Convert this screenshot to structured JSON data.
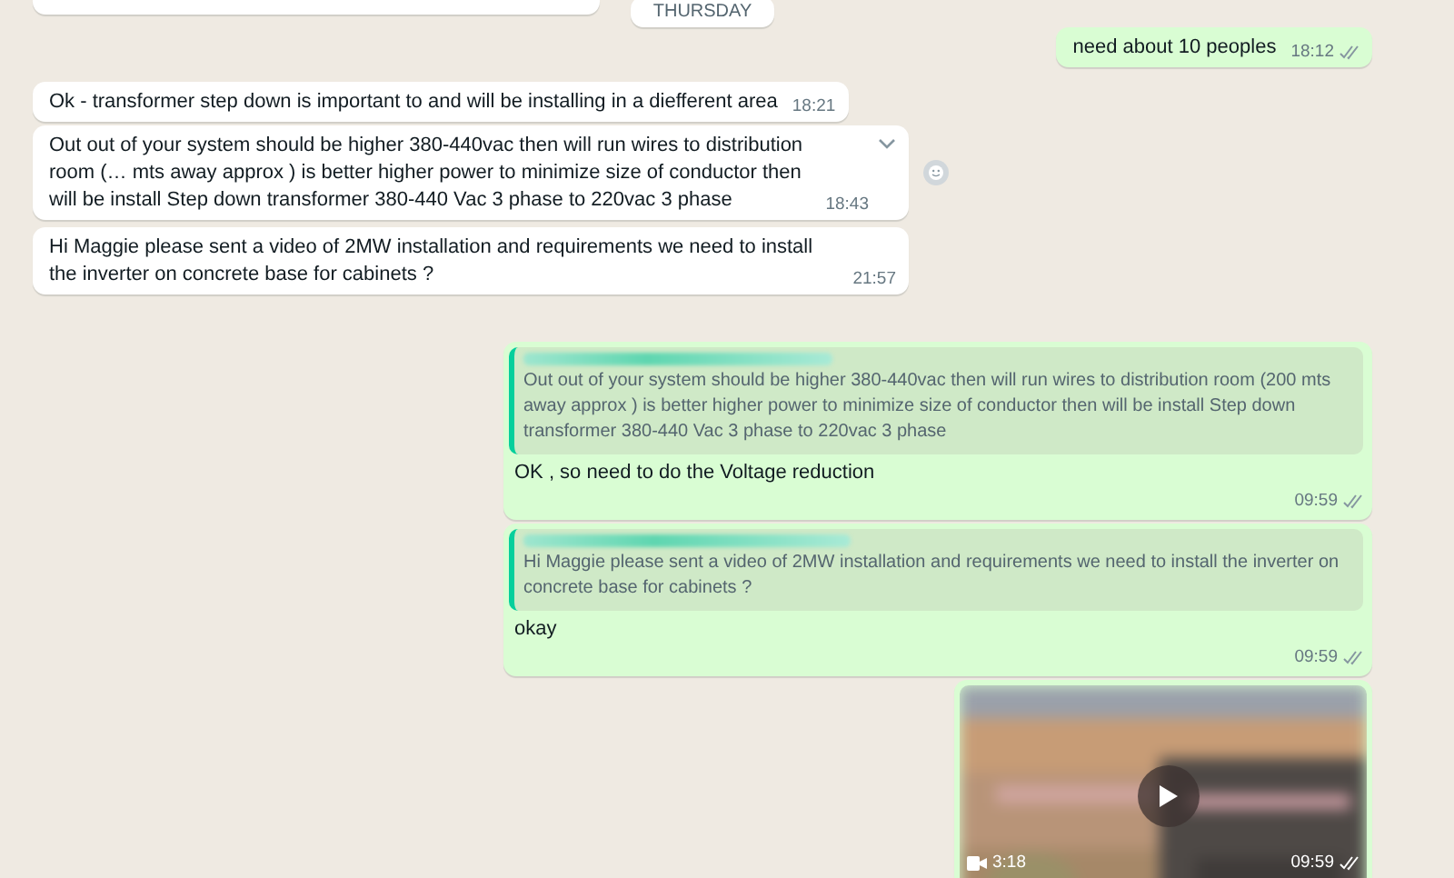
{
  "messages": [
    {
      "kind": "cut_off",
      "from_me": false
    },
    {
      "kind": "date",
      "text": "THURSDAY"
    },
    {
      "kind": "text",
      "from_me": true,
      "text": "need about 10 peoples",
      "time": "18:12",
      "read": false
    },
    {
      "kind": "text",
      "from_me": false,
      "text": "Ok - transformer step down is important to and will be installing in a diefferent area",
      "time": "18:21"
    },
    {
      "kind": "text",
      "from_me": false,
      "text": "Out out of your system should be higher 380-440vac then will run wires to distribution room (… mts away approx ) is better higher power to minimize size of conductor then will be install Step down transformer 380-440 Vac 3 phase to 220vac 3 phase",
      "time": "18:43",
      "menu_open": true,
      "react_button": true
    },
    {
      "kind": "text",
      "from_me": false,
      "text": "Hi Maggie please sent a video of 2MW installation and requirements we need to install the inverter on concrete base for cabinets ?",
      "time": "21:57"
    },
    {
      "kind": "reply",
      "from_me": true,
      "quote": "Out out of your system should be higher 380-440vac then will run wires to distribution room (200 mts away approx ) is better higher power to minimize size of conductor then will be install Step down transformer 380-440 Vac 3 phase to 220vac 3 phase",
      "text": "OK , so need to do the Voltage reduction",
      "time": "09:59",
      "read": false
    },
    {
      "kind": "reply",
      "from_me": true,
      "quote": "Hi Maggie please sent a video of 2MW installation and requirements we need to install the inverter on concrete base for cabinets ?",
      "text": "okay",
      "time": "09:59",
      "read": false
    },
    {
      "kind": "video",
      "from_me": true,
      "duration": "3:18",
      "time": "09:59",
      "read": false
    }
  ]
}
